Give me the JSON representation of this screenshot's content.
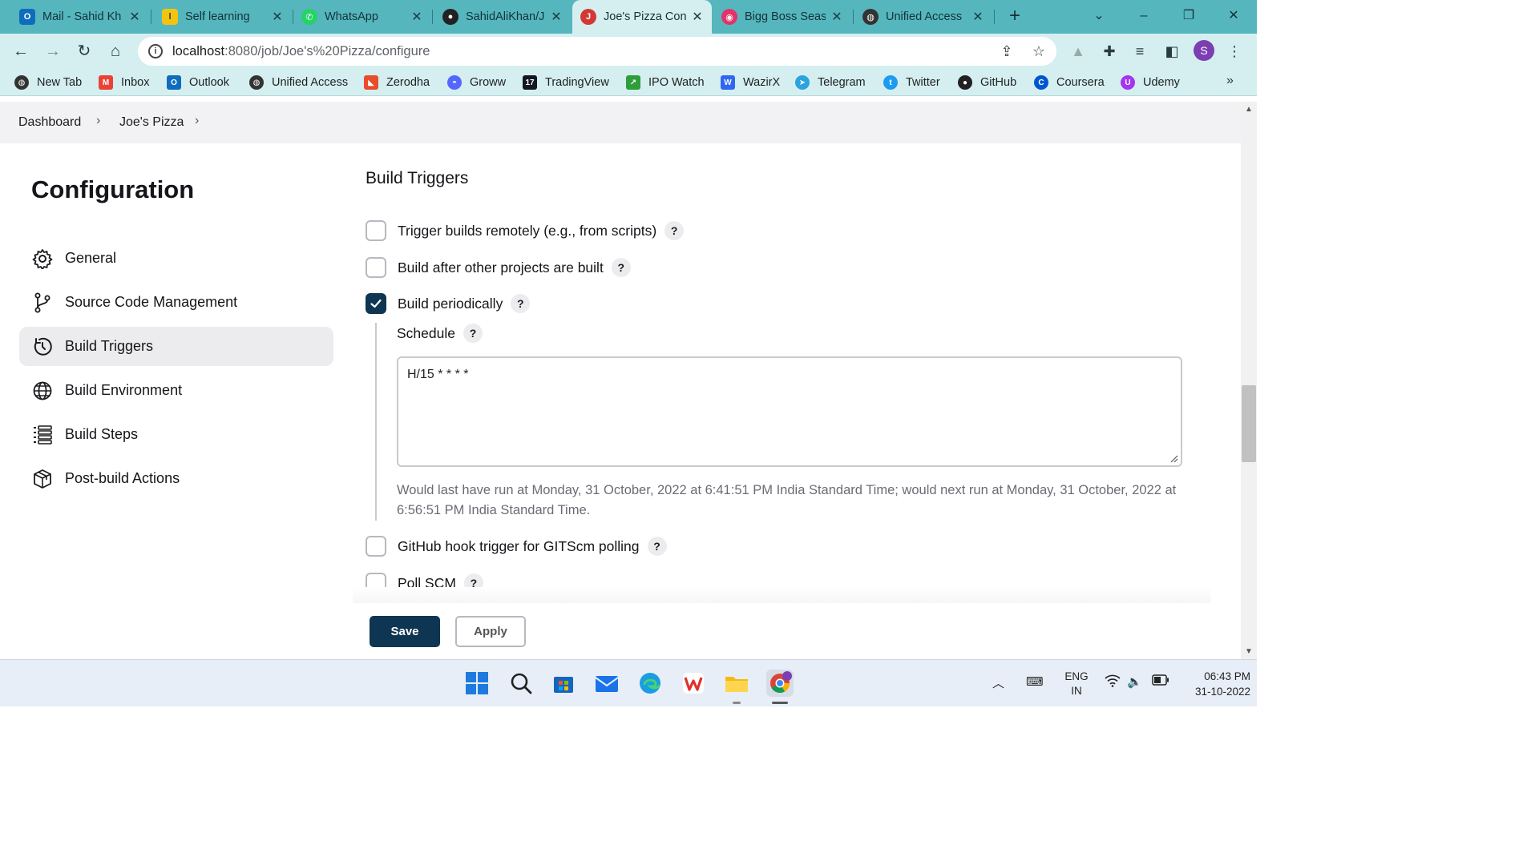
{
  "browser": {
    "tabs": [
      {
        "title": "Mail - Sahid Kh",
        "icon": "outlook-icon",
        "color": "#0f6cbd",
        "active": false
      },
      {
        "title": "Self learning",
        "icon": "self-learning-icon",
        "color": "#f2c40f",
        "active": false
      },
      {
        "title": "WhatsApp",
        "icon": "whatsapp-icon",
        "color": "#25d366",
        "active": false
      },
      {
        "title": "SahidAliKhan/J",
        "icon": "github-icon",
        "color": "#222222",
        "active": false
      },
      {
        "title": "Joe's Pizza Con",
        "icon": "jenkins-icon",
        "color": "#d33833",
        "active": true
      },
      {
        "title": "Bigg Boss Seas",
        "icon": "bigg-boss-icon",
        "color": "#e2336b",
        "active": false
      },
      {
        "title": "Unified Access",
        "icon": "globe-icon",
        "color": "#333333",
        "active": false
      }
    ],
    "url_host": "localhost",
    "url_path": ":8080/job/Joe's%20Pizza/configure",
    "profile_initial": "S",
    "bookmarks": [
      {
        "label": "New Tab",
        "icon": "globe-icon",
        "color": "#333333"
      },
      {
        "label": "Inbox",
        "icon": "gmail-icon",
        "color": "#ea4335"
      },
      {
        "label": "Outlook",
        "icon": "outlook-icon",
        "color": "#0f6cbd"
      },
      {
        "label": "Unified Access",
        "icon": "globe-icon",
        "color": "#333333"
      },
      {
        "label": "Zerodha",
        "icon": "zerodha-icon",
        "color": "#e84c2b"
      },
      {
        "label": "Groww",
        "icon": "groww-icon",
        "color": "#5367ff"
      },
      {
        "label": "TradingView",
        "icon": "tradingview-icon",
        "color": "#131722"
      },
      {
        "label": "IPO Watch",
        "icon": "ipo-watch-icon",
        "color": "#2e9e3a"
      },
      {
        "label": "WazirX",
        "icon": "wazirx-icon",
        "color": "#3067f0"
      },
      {
        "label": "Telegram",
        "icon": "telegram-icon",
        "color": "#2aa3df"
      },
      {
        "label": "Twitter",
        "icon": "twitter-icon",
        "color": "#1d9bf0"
      },
      {
        "label": "GitHub",
        "icon": "github-icon",
        "color": "#222222"
      },
      {
        "label": "Coursera",
        "icon": "coursera-icon",
        "color": "#0056d2"
      },
      {
        "label": "Udemy",
        "icon": "udemy-icon",
        "color": "#a435f0"
      }
    ]
  },
  "breadcrumb": {
    "items": [
      "Dashboard",
      "Joe's Pizza"
    ]
  },
  "sidebar": {
    "title": "Configuration",
    "items": [
      {
        "label": "General",
        "icon": "gear-icon",
        "active": false
      },
      {
        "label": "Source Code Management",
        "icon": "git-branch-icon",
        "active": false
      },
      {
        "label": "Build Triggers",
        "icon": "clock-icon",
        "active": true
      },
      {
        "label": "Build Environment",
        "icon": "globe-icon",
        "active": false
      },
      {
        "label": "Build Steps",
        "icon": "list-icon",
        "active": false
      },
      {
        "label": "Post-build Actions",
        "icon": "package-icon",
        "active": false
      }
    ]
  },
  "build_triggers": {
    "title": "Build Triggers",
    "options": [
      {
        "label": "Trigger builds remotely (e.g., from scripts)",
        "checked": false
      },
      {
        "label": "Build after other projects are built",
        "checked": false
      },
      {
        "label": "Build periodically",
        "checked": true
      },
      {
        "label": "GitHub hook trigger for GITScm polling",
        "checked": false
      },
      {
        "label": "Poll SCM",
        "checked": false
      }
    ],
    "help_glyph": "?",
    "schedule_label": "Schedule",
    "schedule_value": "H/15 * * * *",
    "schedule_note": "Would last have run at Monday, 31 October, 2022 at 6:41:51 PM India Standard Time; would next run at Monday, 31 October, 2022 at 6:56:51 PM India Standard Time."
  },
  "actions": {
    "save_label": "Save",
    "apply_label": "Apply"
  },
  "taskbar": {
    "language_line1": "ENG",
    "language_line2": "IN",
    "time": "06:43 PM",
    "date": "31-10-2022"
  },
  "colors": {
    "tabstrip": "#55b6be",
    "toolbar": "#d5eff1",
    "accent": "#0e3552"
  }
}
